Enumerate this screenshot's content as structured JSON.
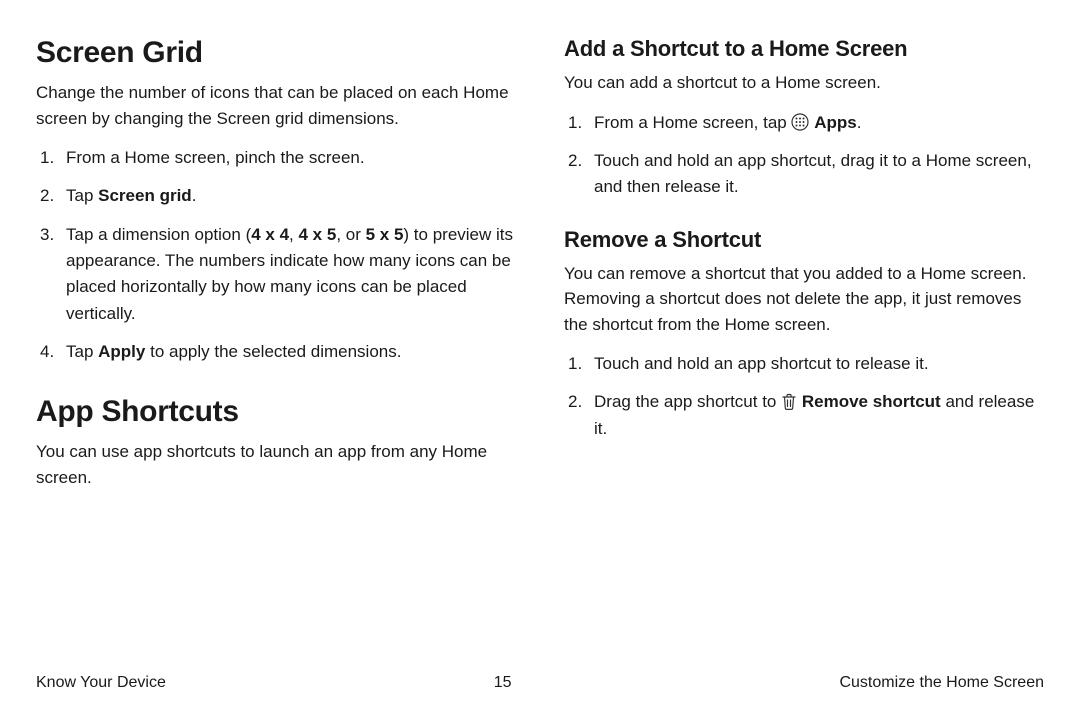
{
  "left": {
    "h1a": "Screen Grid",
    "p1": "Change the number of icons that can be placed on each Home screen by changing the Screen grid dimensions.",
    "steps_a": {
      "s1": "From a Home screen, pinch the screen.",
      "s2_pre": "Tap ",
      "s2_bold": "Screen grid",
      "s2_post": ".",
      "s3_pre": "Tap a dimension option (",
      "s3_b1": "4 x 4",
      "s3_mid1": ", ",
      "s3_b2": "4 x 5",
      "s3_mid2": ", or ",
      "s3_b3": "5 x 5",
      "s3_post": ") to preview its appearance. The numbers indicate how many icons can be placed horizontally by how many icons can be placed vertically.",
      "s4_pre": "Tap ",
      "s4_bold": "Apply",
      "s4_post": " to apply the selected dimensions."
    },
    "h1b": "App Shortcuts",
    "p2": "You can use app shortcuts to launch an app from any Home screen."
  },
  "right": {
    "h2a": "Add a Shortcut to a Home Screen",
    "p1": "You can add a shortcut to a Home screen.",
    "steps_a": {
      "s1_pre": "From a Home screen, tap ",
      "s1_bold": "Apps",
      "s1_post": ".",
      "s2": "Touch and hold an app shortcut, drag it to a Home screen, and then release it."
    },
    "h2b": "Remove a Shortcut",
    "p2": "You can remove a shortcut that you added to a Home screen. Removing a shortcut does not delete the app, it just removes the shortcut from the Home screen.",
    "steps_b": {
      "s1": "Touch and hold an app shortcut to release it.",
      "s2_pre": "Drag the app shortcut to ",
      "s2_bold": "Remove shortcut",
      "s2_post": " and release it."
    }
  },
  "footer": {
    "left": "Know Your Device",
    "center": "15",
    "right": "Customize the Home Screen"
  }
}
